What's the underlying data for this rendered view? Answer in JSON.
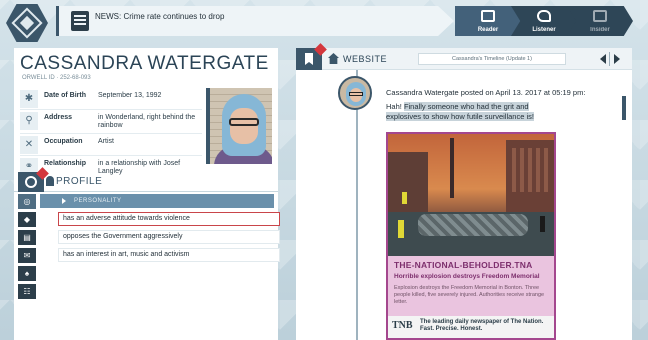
{
  "news": {
    "prefix": "NEWS:",
    "text": "Crime rate continues to drop"
  },
  "modes": [
    {
      "label": "Reader",
      "icon": "book-icon"
    },
    {
      "label": "Listener",
      "icon": "ear-icon"
    },
    {
      "label": "Insider",
      "icon": "monitor-icon"
    }
  ],
  "profile": {
    "name": "CASSANDRA WATERGATE",
    "orwell_id": "ORWELL ID · 252-68-093",
    "fields": [
      {
        "label": "Date of Birth",
        "value": "September 13, 1992",
        "icon": "asterisk-icon"
      },
      {
        "label": "Address",
        "value": "in Wonderland, right behind the rainbow",
        "icon": "location-pin-icon"
      },
      {
        "label": "Occupation",
        "value": "Artist",
        "icon": "tools-icon"
      },
      {
        "label": "Relationship",
        "value": "in a relationship with Josef Langley",
        "icon": "rings-icon"
      }
    ],
    "section_title": "PROFILE",
    "personality_header": "PERSONALITY",
    "traits": [
      "has an adverse attitude towards violence",
      "opposes the Government aggressively",
      "has an interest in art, music and activism"
    ]
  },
  "browser": {
    "section_label": "WEBSITE",
    "url": "Cassandra's Timeline (Update 1)"
  },
  "post": {
    "header": "Cassandra Watergate posted on April 13. 2017 at 05:19 pm:",
    "text_plain": "Hah!",
    "text_highlight": "Finally someone who had the grit and explosives to show how futile surveillance is!"
  },
  "article": {
    "source": "THE-NATIONAL-BEHOLDER.TNA",
    "headline": "Horrible explosion destroys Freedom Memorial",
    "summary": "Explosion destroys the Freedom Memorial in Bonton. Three people killed, five severely injured. Authorities receive strange letter.",
    "footer_logo": "TNB",
    "footer_text": "The leading daily newspaper of The Nation. Fast. Precise. Honest."
  },
  "colors": {
    "accent_dark": "#3b566a",
    "article_border": "#a4478e",
    "alert_red": "#d4373d"
  }
}
